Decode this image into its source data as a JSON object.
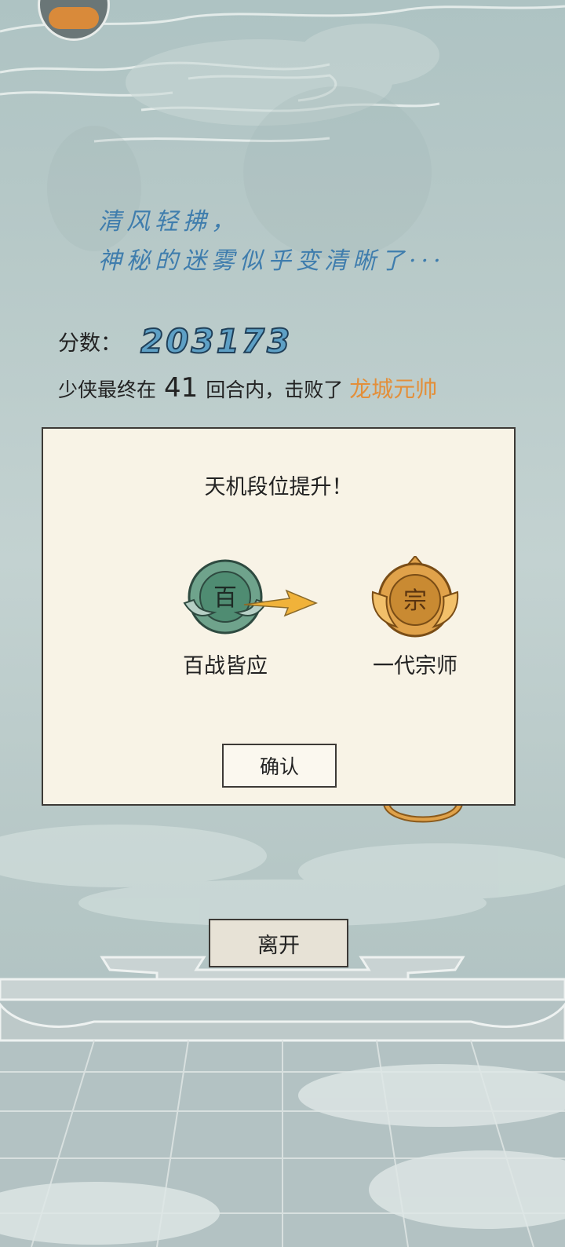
{
  "colors": {
    "poem": "#3f7dad",
    "score": "#5ea0c5",
    "boss": "#e38f3a",
    "modal_bg": "#f8f3e6",
    "jade_badge": "#6fa38c",
    "gold_badge": "#e0a24a"
  },
  "header": {
    "avatar_icon": "avatar-icon"
  },
  "poem": {
    "text": "清风轻拂，\n神秘的迷雾似乎变清晰了···"
  },
  "score": {
    "label": "分数：",
    "value": "203173"
  },
  "result": {
    "prefix": "少侠最终在",
    "rounds": "41",
    "middle": "回合内，击败了",
    "boss": "龙城元帅"
  },
  "modal": {
    "title": "天机段位提升！",
    "from_rank": {
      "badge_char": "百",
      "name": "百战皆应"
    },
    "to_rank": {
      "badge_char": "宗",
      "name": "一代宗师"
    },
    "arrow_icon": "arrow-right-icon",
    "confirm_label": "确认"
  },
  "footer": {
    "leave_label": "离开"
  }
}
